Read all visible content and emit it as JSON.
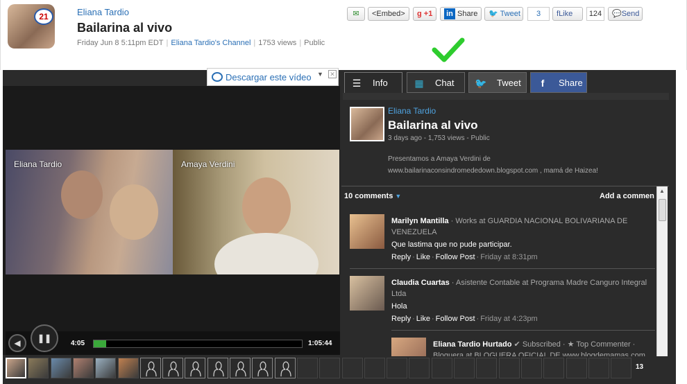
{
  "header": {
    "author": "Eliana Tardio",
    "title": "Bailarina al vivo",
    "date": "Friday Jun 8 5:11pm EDT",
    "channel": "Eliana Tardio's Channel",
    "views": "1753 views",
    "visibility": "Public",
    "logo_text": "21"
  },
  "share": {
    "embed": "<Embed>",
    "gplus": "+1",
    "linkedin_icon": "in",
    "linkedin": "Share",
    "tweet": "Tweet",
    "tweet_count": "3",
    "like": "Like",
    "like_count": "124",
    "send": "Send"
  },
  "download": {
    "label": "Descargar este vídeo"
  },
  "video": {
    "left_name": "Eliana Tardio",
    "right_name": "Amaya Verdini",
    "current_time": "4:05",
    "duration": "1:05:44",
    "progress": 0.06
  },
  "tabs": [
    {
      "label": "Info",
      "icon": "list-icon"
    },
    {
      "label": "Chat",
      "icon": "windows-icon"
    },
    {
      "label": "Tweet",
      "icon": "twitter-bird-icon"
    },
    {
      "label": "Share",
      "icon": "facebook-icon"
    }
  ],
  "info": {
    "author": "Eliana Tardio",
    "title": "Bailarina al vivo",
    "meta": "3 days ago - 1,753 views - Public",
    "description_line1": "Presentamos a Amaya Verdini de",
    "description_line2": "www.bailarinaconsindromededown.blogspot.com , mamá de Haizea!"
  },
  "comments": {
    "header": "10 comments",
    "add": "Add a commen",
    "items": [
      {
        "name": "Marilyn Mantilla",
        "work": "Works at GUARDIA NACIONAL BOLIVARIANA DE VENEZUELA",
        "text": "Que lastima que no pude participar.",
        "reply": "Reply",
        "like": "Like",
        "follow": "Follow Post",
        "time": "Friday at 8:31pm"
      },
      {
        "name": "Claudia Cuartas",
        "work": "Asistente Contable at Programa Madre Canguro Integral Ltda",
        "text": "Hola",
        "reply": "Reply",
        "like": "Like",
        "follow": "Follow Post",
        "time": "Friday at 4:23pm"
      },
      {
        "name": "Eliana Tardio Hurtado",
        "subscribed": "✔ Subscribed",
        "top": "★ Top Commenter",
        "work": "Bloguera at BLOGUERA OFICIAL DE www.blogdemamas.com"
      }
    ]
  },
  "strip": {
    "count": "13"
  }
}
